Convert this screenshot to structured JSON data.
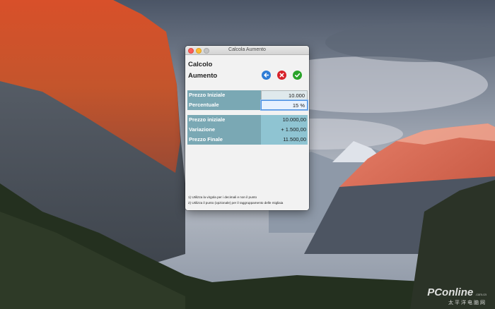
{
  "window": {
    "title": "Calcola Aumento"
  },
  "header": {
    "line1": "Calcolo",
    "line2": "Aumento"
  },
  "actions": {
    "back_icon": "back-arrow-icon",
    "cancel_icon": "x-icon",
    "confirm_icon": "checkmark-icon"
  },
  "inputs": [
    {
      "label": "Prezzo Iniziale",
      "value": "10.000"
    },
    {
      "label": "Percentuale",
      "value": "15",
      "suffix": "%"
    }
  ],
  "results": [
    {
      "label": "Prezzo iniziale",
      "value": "10.000,00"
    },
    {
      "label": "Variazione",
      "value": "+ 1.500,00"
    },
    {
      "label": "Prezzo Finale",
      "value": "11.500,00"
    }
  ],
  "notes": [
    "1) Utilizza la virgola per i decimali e non il punto",
    "2) Utilizza il punto (opzionale) per il raggruppamento delle migliaia"
  ],
  "watermark": {
    "brand": "PConline",
    "domain": ".com.cn",
    "chinese": "太平洋电脑网"
  }
}
